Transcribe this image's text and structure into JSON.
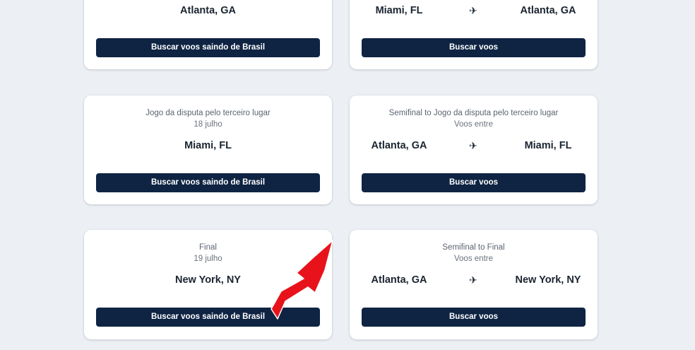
{
  "cards": [
    {
      "city": "Atlanta, GA",
      "button": "Buscar voos saindo de Brasil"
    },
    {
      "from": "Miami, FL",
      "to": "Atlanta, GA",
      "plane_icon": "airplane-icon",
      "button": "Buscar voos"
    },
    {
      "title": "Jogo da disputa pelo terceiro lugar",
      "date": "18 julho",
      "city": "Miami, FL",
      "button": "Buscar voos saindo de Brasil"
    },
    {
      "title": "Semifinal to Jogo da disputa pelo terceiro lugar",
      "subtitle": "Voos entre",
      "from": "Atlanta, GA",
      "to": "Miami, FL",
      "plane_icon": "airplane-icon",
      "button": "Buscar voos"
    },
    {
      "title": "Final",
      "date": "19 julho",
      "city": "New York, NY",
      "button": "Buscar voos saindo de Brasil"
    },
    {
      "title": "Semifinal to Final",
      "subtitle": "Voos entre",
      "from": "Atlanta, GA",
      "to": "New York, NY",
      "plane_icon": "airplane-icon",
      "button": "Buscar voos"
    }
  ],
  "colors": {
    "page_background": "#ecf0f4",
    "card_background": "#ffffff",
    "button_background": "#0f2443",
    "button_text": "#ffffff",
    "annotation_arrow": "#e8121b"
  },
  "annotation": {
    "icon": "red-arrow-icon"
  }
}
